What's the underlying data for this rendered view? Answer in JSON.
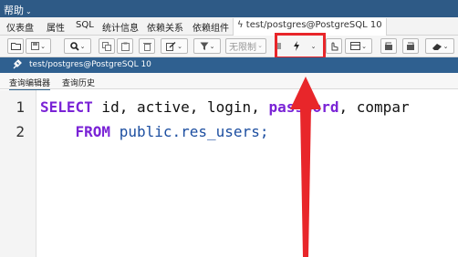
{
  "menubar": {
    "help_label": "帮助",
    "help_chevron": "⌄"
  },
  "tabs": [
    {
      "label": "仪表盘"
    },
    {
      "label": "属性"
    },
    {
      "label": "SQL"
    },
    {
      "label": "统计信息"
    },
    {
      "label": "依赖关系"
    },
    {
      "label": "依赖组件"
    },
    {
      "label": "ϟ test/postgres@PostgreSQL 10",
      "active": true
    }
  ],
  "toolbar": {
    "limit_value": "无限制",
    "dropdown_caret": "⌄",
    "execute_icon": "lightning-icon"
  },
  "connection": {
    "title": "test/postgres@PostgreSQL 10",
    "icon": "plug-icon"
  },
  "subtabs": [
    {
      "label": "查询编辑器",
      "active": true
    },
    {
      "label": "查询历史"
    }
  ],
  "editor": {
    "lines": [
      {
        "number": "1",
        "kw1": "SELECT",
        "text1": " id, active, login, ",
        "kw2": "password",
        "text2": ", compar"
      },
      {
        "number": "2",
        "indent": "    ",
        "kw1": "FROM",
        "fn1": " public.",
        "text1": "res_users;"
      }
    ]
  },
  "colors": {
    "menubar_bg": "#2e5a86",
    "connection_bg": "#2f6090",
    "highlight": "#e8262a",
    "keyword": "#7a23d6"
  }
}
